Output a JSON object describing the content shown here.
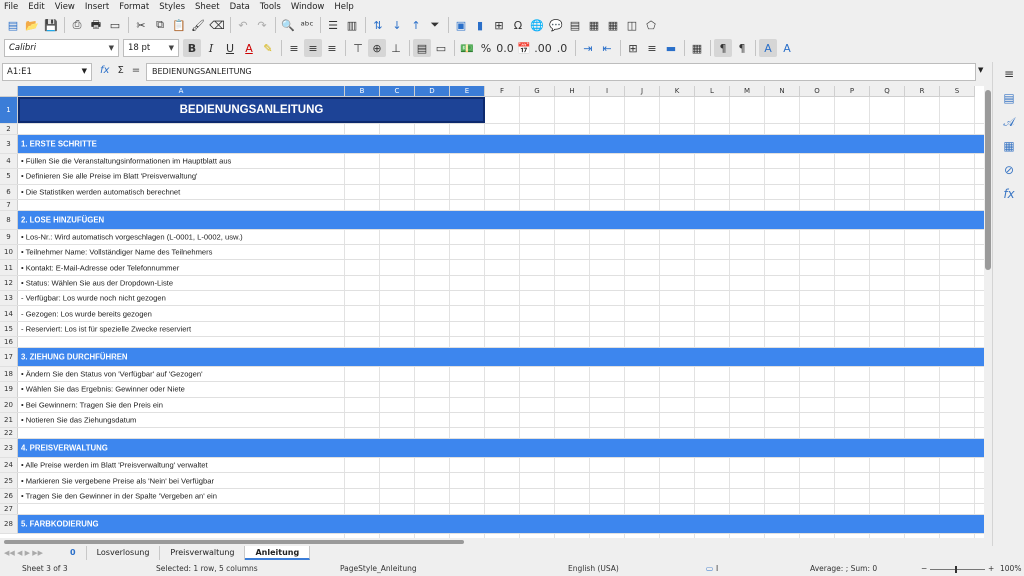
{
  "menu": [
    "File",
    "Edit",
    "View",
    "Insert",
    "Format",
    "Styles",
    "Sheet",
    "Data",
    "Tools",
    "Window",
    "Help"
  ],
  "toolbar": {
    "font_name": "Calibri",
    "font_size": "18 pt"
  },
  "formula_bar": {
    "name_box": "A1:E1",
    "content": "BEDIENUNGSANLEITUNG",
    "fx_glyph": "fx",
    "sum_glyph": "Σ",
    "eq_glyph": "="
  },
  "columns": [
    "A",
    "B",
    "C",
    "D",
    "E",
    "F",
    "G",
    "H",
    "I",
    "J",
    "K",
    "L",
    "M",
    "N",
    "O",
    "P",
    "Q",
    "R",
    "S"
  ],
  "rows": [
    {
      "n": "1",
      "type": "title",
      "text": "BEDIENUNGSANLEITUNG"
    },
    {
      "n": "2",
      "type": "blank",
      "text": ""
    },
    {
      "n": "3",
      "type": "section",
      "text": "1. ERSTE SCHRITTE"
    },
    {
      "n": "4",
      "type": "item",
      "text": "• Füllen Sie die Veranstaltungsinformationen im Hauptblatt aus"
    },
    {
      "n": "5",
      "type": "item",
      "text": "• Definieren Sie alle Preise im Blatt 'Preisverwaltung'"
    },
    {
      "n": "6",
      "type": "item",
      "text": "• Die Statistiken werden automatisch berechnet"
    },
    {
      "n": "7",
      "type": "blank",
      "text": ""
    },
    {
      "n": "8",
      "type": "section",
      "text": "2. LOSE HINZUFÜGEN"
    },
    {
      "n": "9",
      "type": "item",
      "text": "• Los-Nr.: Wird automatisch vorgeschlagen (L-0001, L-0002, usw.)"
    },
    {
      "n": "10",
      "type": "item",
      "text": "• Teilnehmer Name: Vollständiger Name des Teilnehmers"
    },
    {
      "n": "11",
      "type": "item",
      "text": "• Kontakt: E-Mail-Adresse oder Telefonnummer"
    },
    {
      "n": "12",
      "type": "item",
      "text": "• Status: Wählen Sie aus der Dropdown-Liste"
    },
    {
      "n": "13",
      "type": "item",
      "text": "  - Verfügbar: Los wurde noch nicht gezogen"
    },
    {
      "n": "14",
      "type": "item",
      "text": "  - Gezogen: Los wurde bereits gezogen"
    },
    {
      "n": "15",
      "type": "item",
      "text": "  - Reserviert: Los ist für spezielle Zwecke reserviert"
    },
    {
      "n": "16",
      "type": "blank",
      "text": ""
    },
    {
      "n": "17",
      "type": "section",
      "text": "3. ZIEHUNG DURCHFÜHREN"
    },
    {
      "n": "18",
      "type": "item",
      "text": "• Ändern Sie den Status von 'Verfügbar' auf 'Gezogen'"
    },
    {
      "n": "19",
      "type": "item",
      "text": "• Wählen Sie das Ergebnis: Gewinner oder Niete"
    },
    {
      "n": "20",
      "type": "item",
      "text": "• Bei Gewinnern: Tragen Sie den Preis ein"
    },
    {
      "n": "21",
      "type": "item",
      "text": "• Notieren Sie das Ziehungsdatum"
    },
    {
      "n": "22",
      "type": "blank",
      "text": ""
    },
    {
      "n": "23",
      "type": "section",
      "text": "4. PREISVERWALTUNG"
    },
    {
      "n": "24",
      "type": "item",
      "text": "• Alle Preise werden im Blatt 'Preisverwaltung' verwaltet"
    },
    {
      "n": "25",
      "type": "item",
      "text": "• Markieren Sie vergebene Preise als 'Nein' bei Verfügbar"
    },
    {
      "n": "26",
      "type": "item",
      "text": "• Tragen Sie den Gewinner in der Spalte 'Vergeben an' ein"
    },
    {
      "n": "27",
      "type": "blank",
      "text": ""
    },
    {
      "n": "28",
      "type": "section",
      "text": "5. FARBKODIERUNG"
    }
  ],
  "sheet_tabs": {
    "add_label": "0",
    "tabs": [
      "Losverlosung",
      "Preisverwaltung",
      "Anleitung"
    ],
    "active": "Anleitung"
  },
  "status_bar": {
    "sheet": "Sheet 3 of 3",
    "selection": "Selected: 1 row, 5 columns",
    "page_style": "PageStyle_Anleitung",
    "language": "English (USA)",
    "summary": "Average: ; Sum: 0",
    "zoom": "100%"
  },
  "colors": {
    "title_fill": "#1d4396",
    "section_fill": "#3d86ee",
    "selection_header": "#3b7dd8"
  }
}
